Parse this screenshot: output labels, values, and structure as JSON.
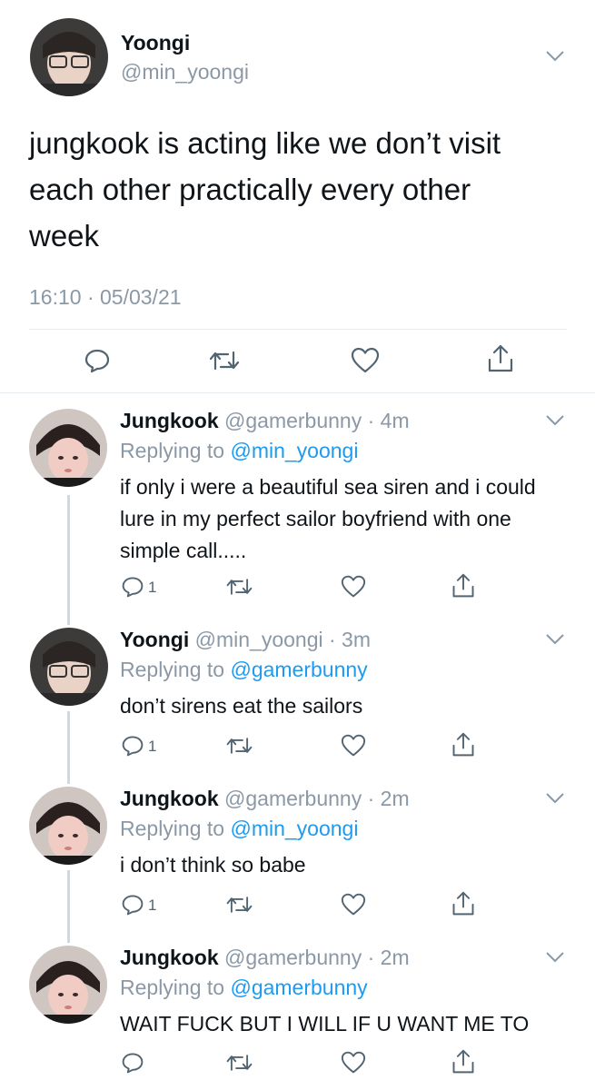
{
  "main_tweet": {
    "display_name": "Yoongi",
    "handle": "@min_yoongi",
    "text": "jungkook is acting like we don’t visit each other practically every other week",
    "timestamp": "16:10 · 05/03/21"
  },
  "replies": [
    {
      "display_name": "Jungkook",
      "handle": "@gamerbunny",
      "time": "· 4m",
      "replying_label": "Replying to",
      "replying_handle": "@min_yoongi",
      "text": "if only i were a beautiful sea siren and i could lure in my perfect sailor boyfriend with one simple call.....",
      "reply_count": "1"
    },
    {
      "display_name": "Yoongi",
      "handle": "@min_yoongi",
      "time": "· 3m",
      "replying_label": "Replying to",
      "replying_handle": "@gamerbunny",
      "text": "don’t sirens eat the sailors",
      "reply_count": "1"
    },
    {
      "display_name": "Jungkook",
      "handle": "@gamerbunny",
      "time": "· 2m",
      "replying_label": "Replying to",
      "replying_handle": "@min_yoongi",
      "text": "i don’t think so babe",
      "reply_count": "1"
    },
    {
      "display_name": "Jungkook",
      "handle": "@gamerbunny",
      "time": "· 2m",
      "replying_label": "Replying to",
      "replying_handle": "@gamerbunny",
      "text": "WAIT FUCK BUT I WILL IF U WANT ME TO",
      "reply_count": ""
    }
  ],
  "icons": {
    "reply": "reply-icon",
    "retweet": "retweet-icon",
    "like": "like-icon",
    "share": "share-icon",
    "menu": "chevron-down-icon"
  },
  "colors": {
    "link": "#1d9bf0",
    "muted": "#8b98a5",
    "text": "#0f1419",
    "divider": "#e6ecf0"
  }
}
